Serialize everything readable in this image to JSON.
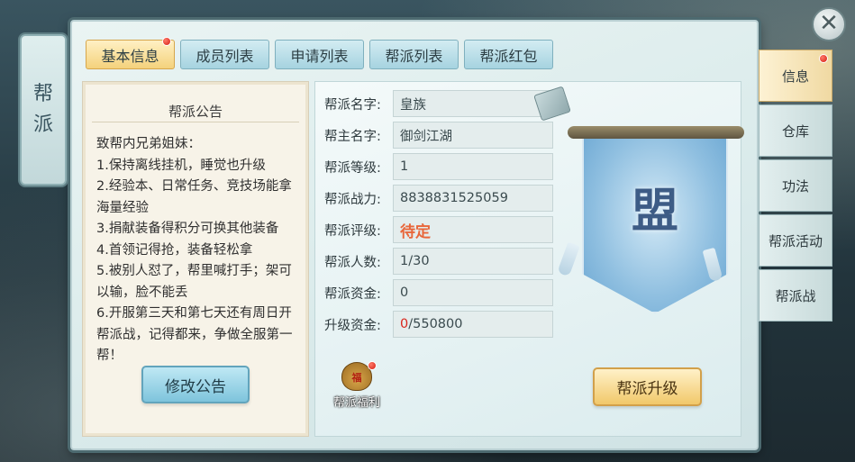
{
  "banner": {
    "line1": "帮",
    "line2": "派"
  },
  "tabs": [
    {
      "label": "基本信息",
      "active": true,
      "badge": true
    },
    {
      "label": "成员列表",
      "active": false
    },
    {
      "label": "申请列表",
      "active": false
    },
    {
      "label": "帮派列表",
      "active": false
    },
    {
      "label": "帮派红包",
      "active": false
    }
  ],
  "notice": {
    "title": "帮派公告",
    "lines": [
      "致帮内兄弟姐妹：",
      "1.保持离线挂机，睡觉也升级",
      "2.经验本、日常任务、竞技场能拿海量经验",
      "3.捐献装备得积分可换其他装备",
      "4.首领记得抢，装备轻松拿",
      "5.被别人怼了，帮里喊打手；架可以输，脸不能丢",
      "6.开服第三天和第七天还有周日开帮派战，记得都来，争做全服第一帮！"
    ],
    "edit_button": "修改公告"
  },
  "info": {
    "name_label": "帮派名字:",
    "name": "皇族",
    "leader_label": "帮主名字:",
    "leader": "御剑江湖",
    "level_label": "帮派等级:",
    "level": "1",
    "power_label": "帮派战力:",
    "power": "8838831525059",
    "rating_label": "帮派评级:",
    "rating": "待定",
    "members_label": "帮派人数:",
    "members": "1/30",
    "funds_label": "帮派资金:",
    "funds": "0",
    "upgrade_funds_label": "升级资金:",
    "upgrade_current": "0",
    "upgrade_required": "/550800"
  },
  "flag": {
    "char": "盟"
  },
  "welfare_label": "帮派福利",
  "upgrade_button": "帮派升级",
  "side_tabs": [
    {
      "label": "信息",
      "active": true
    },
    {
      "label": "仓库",
      "active": false
    },
    {
      "label": "功法",
      "active": false
    },
    {
      "label": "帮派活动",
      "active": false
    },
    {
      "label": "帮派战",
      "active": false
    }
  ],
  "close_glyph": "✕",
  "colors": {
    "accent_gold": "#f1c86a",
    "tab_blue": "#a6d3e0",
    "rating": "#e8663a",
    "alert_red": "#d9261c"
  }
}
